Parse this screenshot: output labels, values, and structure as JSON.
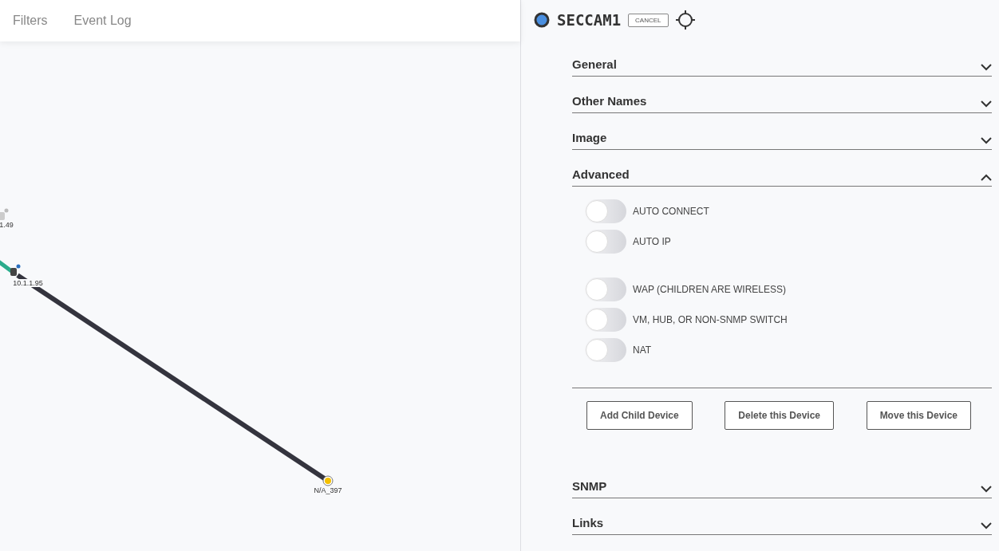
{
  "nav": {
    "tabs": [
      {
        "label": "Filters",
        "selected": false
      },
      {
        "label": "Event Log",
        "selected": false
      }
    ]
  },
  "map": {
    "nodes": [
      {
        "kind": "camera",
        "label": "1.49"
      },
      {
        "kind": "camera",
        "label": "10.1.1.95"
      },
      {
        "kind": "unknown",
        "label": "N/A_397"
      }
    ],
    "links": [
      {
        "color": "#2bab8c"
      },
      {
        "color": "#34343e"
      }
    ]
  },
  "device": {
    "name": "SECCAM1",
    "cancel": "CANCEL"
  },
  "sections_top": [
    {
      "title": "General",
      "expanded": false
    },
    {
      "title": "Other Names",
      "expanded": false
    },
    {
      "title": "Image",
      "expanded": false
    },
    {
      "title": "Advanced",
      "expanded": true
    }
  ],
  "advanced": {
    "toggle_groups": [
      [
        {
          "label": "AUTO CONNECT",
          "on": false
        },
        {
          "label": "AUTO IP",
          "on": false
        }
      ],
      [
        {
          "label": "WAP (CHILDREN ARE WIRELESS)",
          "on": false
        },
        {
          "label": "VM, HUB, OR NON-SNMP SWITCH",
          "on": false
        },
        {
          "label": "NAT",
          "on": false
        }
      ]
    ],
    "buttons": [
      "Add Child Device",
      "Delete this Device",
      "Move this Device"
    ]
  },
  "sections_bottom": [
    {
      "title": "SNMP",
      "expanded": false
    },
    {
      "title": "Links",
      "expanded": false
    }
  ]
}
